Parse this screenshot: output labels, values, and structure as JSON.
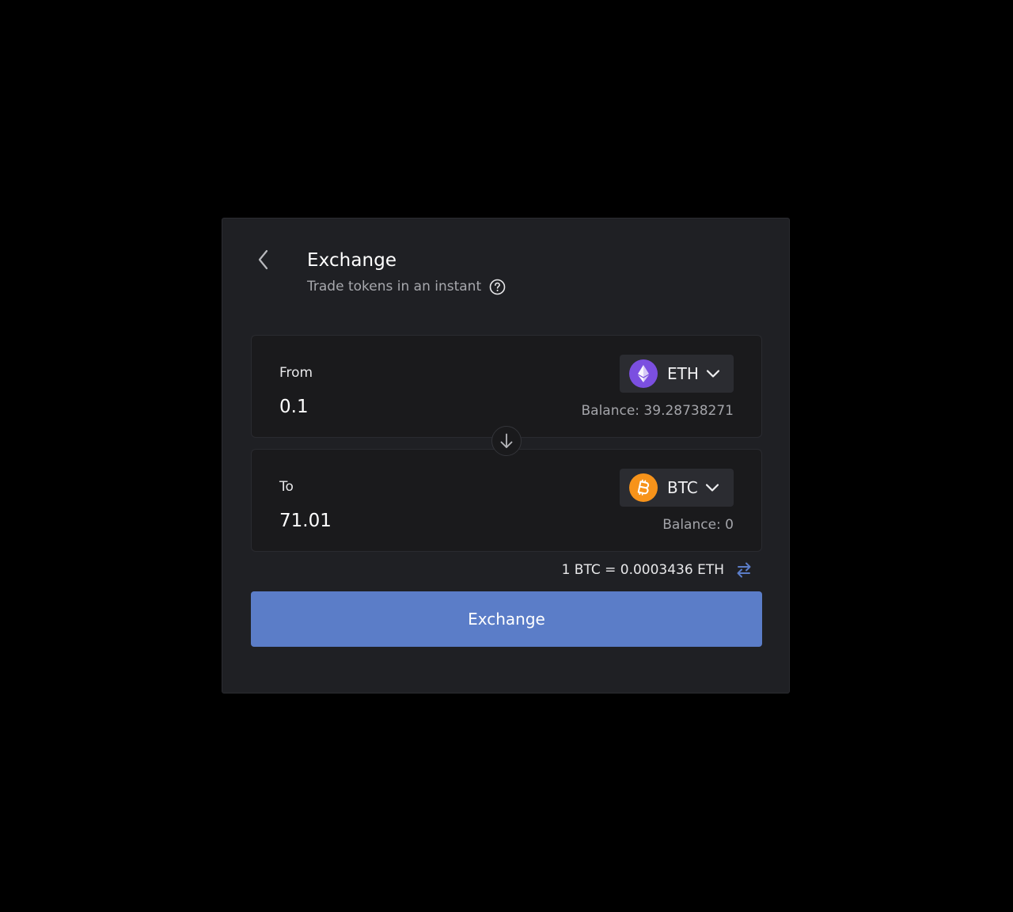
{
  "header": {
    "title": "Exchange",
    "subtitle": "Trade tokens in an instant"
  },
  "from": {
    "label": "From",
    "value": "0.1",
    "token": {
      "symbol": "ETH",
      "icon": "ethereum-icon",
      "color": "#7b4fe0"
    },
    "balance": "Balance: 39.28738271"
  },
  "to": {
    "label": "To",
    "value": "71.01",
    "token": {
      "symbol": "BTC",
      "icon": "bitcoin-icon",
      "color": "#f7931a"
    },
    "balance": "Balance: 0"
  },
  "rate": {
    "text": "1 BTC = 0.0003436 ETH"
  },
  "actions": {
    "exchange_label": "Exchange"
  },
  "colors": {
    "accent": "#5b7dc8",
    "panel": "#1f2024",
    "card": "#1a1a1c",
    "rate_icon": "#5b7dc8"
  }
}
